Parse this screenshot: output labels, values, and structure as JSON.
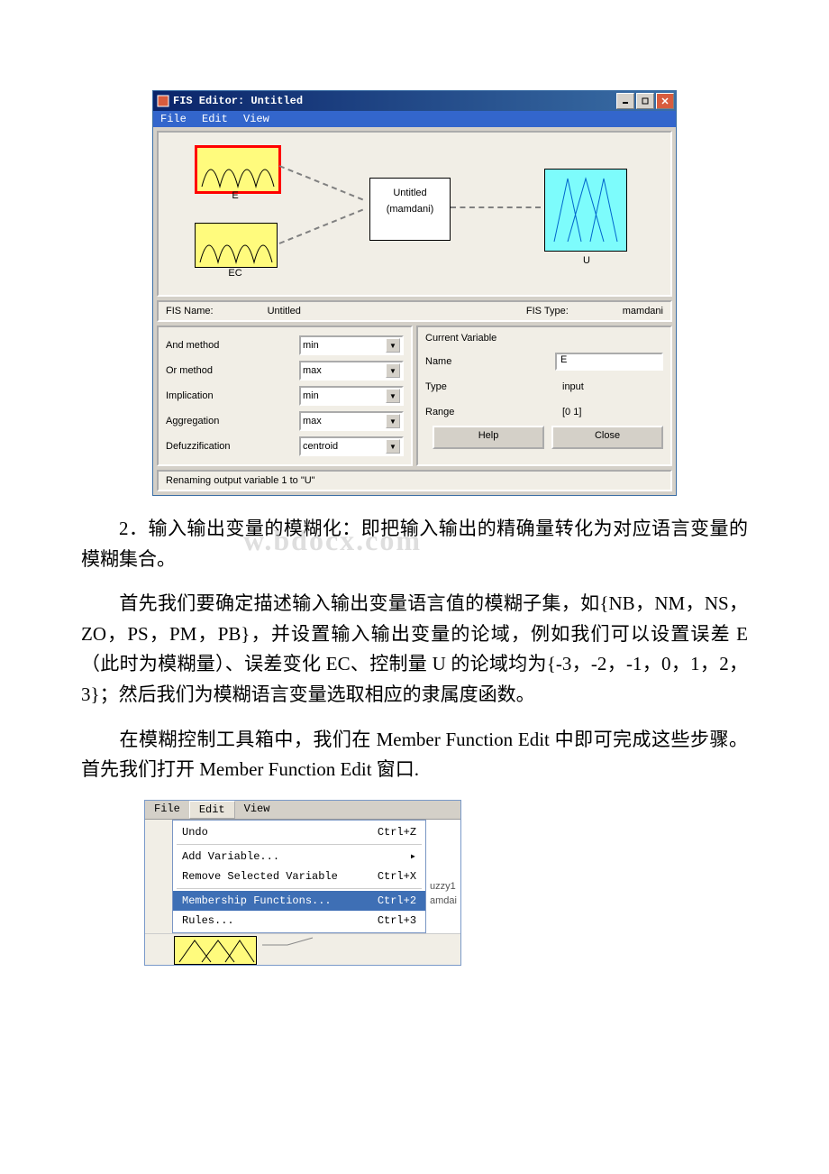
{
  "fis_window": {
    "title": "FIS Editor: Untitled",
    "menu": {
      "file": "File",
      "edit": "Edit",
      "view": "View"
    },
    "diagram": {
      "input1": "E",
      "input2": "EC",
      "center_line1": "Untitled",
      "center_line2": "(mamdani)",
      "output": "U"
    },
    "name_row": {
      "fis_name_label": "FIS Name:",
      "fis_name_value": "Untitled",
      "fis_type_label": "FIS Type:",
      "fis_type_value": "mamdani"
    },
    "left_params": {
      "and_label": "And method",
      "and_value": "min",
      "or_label": "Or method",
      "or_value": "max",
      "imp_label": "Implication",
      "imp_value": "min",
      "agg_label": "Aggregation",
      "agg_value": "max",
      "defuzz_label": "Defuzzification",
      "defuzz_value": "centroid"
    },
    "right_params": {
      "header": "Current Variable",
      "name_label": "Name",
      "name_value": "E",
      "type_label": "Type",
      "type_value": "input",
      "range_label": "Range",
      "range_value": "[0 1]",
      "help_btn": "Help",
      "close_btn": "Close"
    },
    "status": "Renaming output variable 1 to \"U\""
  },
  "para1": "2．输入输出变量的模糊化：即把输入输出的精确量转化为对应语言变量的模糊集合。",
  "para2": "首先我们要确定描述输入输出变量语言值的模糊子集，如{NB，NM，NS，ZO，PS，PM，PB}，并设置输入输出变量的论域，例如我们可以设置误差 E（此时为模糊量）、误差变化 EC、控制量 U 的论域均为{-3，-2，-1，0，1，2，3}；然后我们为模糊语言变量选取相应的隶属度函数。",
  "para3": "在模糊控制工具箱中，我们在 Member Function Edit 中即可完成这些步骤。首先我们打开 Member Function Edit 窗口.",
  "menu_shot": {
    "menubar": {
      "file": "File",
      "edit": "Edit",
      "view": "View"
    },
    "items": {
      "undo": "Undo",
      "undo_sc": "Ctrl+Z",
      "addvar": "Add Variable...",
      "remvar": "Remove Selected Variable",
      "remvar_sc": "Ctrl+X",
      "mf": "Membership Functions...",
      "mf_sc": "Ctrl+2",
      "rules": "Rules...",
      "rules_sc": "Ctrl+3"
    },
    "side1": "uzzy1",
    "side2": "amdai"
  }
}
